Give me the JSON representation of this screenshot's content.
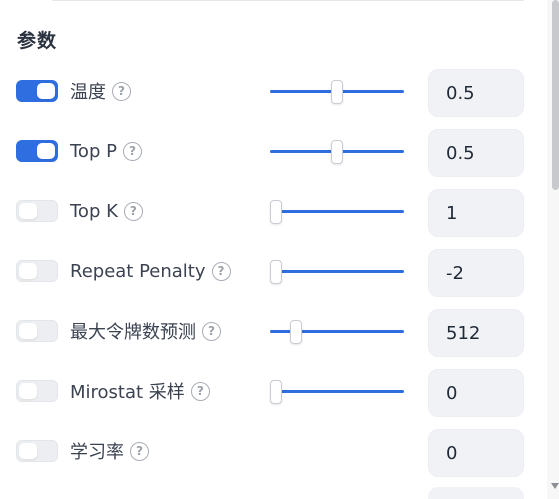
{
  "section": {
    "title": "参数"
  },
  "params": [
    {
      "label": "温度",
      "enabled": true,
      "slider": 0.5,
      "value": "0.5",
      "has_slider": true
    },
    {
      "label": "Top P",
      "enabled": true,
      "slider": 0.5,
      "value": "0.5",
      "has_slider": true
    },
    {
      "label": "Top K",
      "enabled": false,
      "slider": 0.0,
      "value": "1",
      "has_slider": true
    },
    {
      "label": "Repeat Penalty",
      "enabled": false,
      "slider": 0.0,
      "value": "-2",
      "has_slider": true
    },
    {
      "label": "最大令牌数预测",
      "enabled": false,
      "slider": 0.16,
      "value": "512",
      "has_slider": true
    },
    {
      "label": "Mirostat 采样",
      "enabled": false,
      "slider": 0.0,
      "value": "0",
      "has_slider": true
    },
    {
      "label": "学习率",
      "enabled": false,
      "slider": null,
      "value": "0",
      "has_slider": false
    }
  ],
  "help_glyph": "?",
  "icons": {
    "help": "help-circle-icon",
    "scroll_down": "chevron-down-icon"
  },
  "colors": {
    "accent": "#2f6ee0",
    "input_bg": "#f1f2f5",
    "toggle_off": "#eceef1"
  }
}
